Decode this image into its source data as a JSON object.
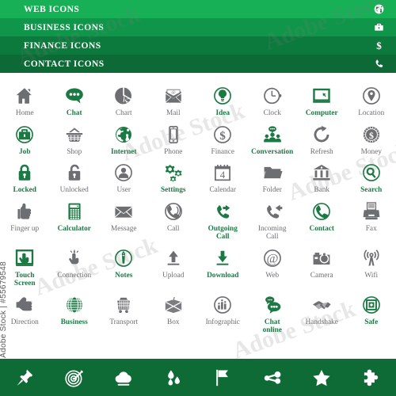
{
  "header": {
    "bars": [
      {
        "title": "WEB ICONS",
        "icon": "globe-icon",
        "bg": "#18b057"
      },
      {
        "title": "BUSINESS ICONS",
        "icon": "briefcase-icon",
        "bg": "#10964a"
      },
      {
        "title": "FINANCE ICONS",
        "icon": "dollar-icon",
        "bg": "#0b7a3c"
      },
      {
        "title": "CONTACT ICONS",
        "icon": "phone-icon",
        "bg": "#0d6a36"
      }
    ]
  },
  "colors": {
    "gray": "#6d6e71",
    "green": "#1b7a43",
    "bottom_bar_bg": "#0e6b36",
    "page_bg": "#ffffff"
  },
  "grid": {
    "rows": [
      [
        {
          "label": "Home",
          "icon": "home-icon",
          "color": "gray"
        },
        {
          "label": "Chat",
          "icon": "chat-bubble-icon",
          "color": "green"
        },
        {
          "label": "Chart",
          "icon": "pie-chart-icon",
          "color": "gray"
        },
        {
          "label": "Mail",
          "icon": "envelope-at-icon",
          "color": "gray"
        },
        {
          "label": "Idea",
          "icon": "lightbulb-icon",
          "color": "green"
        },
        {
          "label": "Clock",
          "icon": "clock-icon",
          "color": "gray"
        },
        {
          "label": "Computer",
          "icon": "laptop-icon",
          "color": "green"
        },
        {
          "label": "Location",
          "icon": "map-pin-icon",
          "color": "gray"
        }
      ],
      [
        {
          "label": "Job",
          "icon": "briefcase-icon",
          "color": "green"
        },
        {
          "label": "Shop",
          "icon": "basket-icon",
          "color": "gray"
        },
        {
          "label": "Internet",
          "icon": "globe-icon",
          "color": "green"
        },
        {
          "label": "Phone",
          "icon": "smartphone-icon",
          "color": "gray"
        },
        {
          "label": "Finance",
          "icon": "dollar-circle-icon",
          "color": "gray"
        },
        {
          "label": "Conversation",
          "icon": "group-chat-icon",
          "color": "green"
        },
        {
          "label": "Refresh",
          "icon": "refresh-arrow-icon",
          "color": "gray"
        },
        {
          "label": "Money",
          "icon": "coin-icon",
          "color": "gray"
        }
      ],
      [
        {
          "label": "Locked",
          "icon": "padlock-closed-icon",
          "color": "green"
        },
        {
          "label": "Unlocked",
          "icon": "padlock-open-icon",
          "color": "gray"
        },
        {
          "label": "User",
          "icon": "user-avatar-icon",
          "color": "gray"
        },
        {
          "label": "Settings",
          "icon": "gears-icon",
          "color": "green"
        },
        {
          "label": "Calendar",
          "icon": "calendar-icon",
          "color": "gray",
          "badge": "4"
        },
        {
          "label": "Folder",
          "icon": "folder-icon",
          "color": "gray"
        },
        {
          "label": "Bank",
          "icon": "bank-building-icon",
          "color": "gray"
        },
        {
          "label": "Search",
          "icon": "magnifier-icon",
          "color": "green"
        }
      ],
      [
        {
          "label": "Finger up",
          "icon": "thumbs-up-icon",
          "color": "gray"
        },
        {
          "label": "Calculator",
          "icon": "calculator-icon",
          "color": "green"
        },
        {
          "label": "Message",
          "icon": "envelope-icon",
          "color": "gray"
        },
        {
          "label": "Call",
          "icon": "phone-ringing-icon",
          "color": "gray"
        },
        {
          "label": "Outgoing\nCall",
          "icon": "outgoing-call-icon",
          "color": "green"
        },
        {
          "label": "Incoming\nCall",
          "icon": "incoming-call-icon",
          "color": "gray"
        },
        {
          "label": "Contact",
          "icon": "phone-circle-icon",
          "color": "green"
        },
        {
          "label": "Fax",
          "icon": "fax-printer-icon",
          "color": "gray"
        }
      ],
      [
        {
          "label": "Touch\nScreen",
          "icon": "touch-screen-icon",
          "color": "green"
        },
        {
          "label": "Connection",
          "icon": "pointing-hand-icon",
          "color": "gray"
        },
        {
          "label": "Notes",
          "icon": "pencil-circle-icon",
          "color": "green"
        },
        {
          "label": "Upload",
          "icon": "upload-arrow-icon",
          "color": "gray"
        },
        {
          "label": "Download",
          "icon": "download-arrow-icon",
          "color": "green"
        },
        {
          "label": "Web",
          "icon": "at-circle-icon",
          "color": "gray"
        },
        {
          "label": "Camera",
          "icon": "camera-icon",
          "color": "gray"
        },
        {
          "label": "Wifi",
          "icon": "wifi-tower-icon",
          "color": "gray"
        }
      ],
      [
        {
          "label": "Direction",
          "icon": "pointing-finger-icon",
          "color": "gray"
        },
        {
          "label": "Business",
          "icon": "wire-globe-icon",
          "color": "green"
        },
        {
          "label": "Transport",
          "icon": "cargo-wagon-icon",
          "color": "gray"
        },
        {
          "label": "Box",
          "icon": "package-box-icon",
          "color": "gray"
        },
        {
          "label": "Infographic",
          "icon": "bar-chart-circle-icon",
          "color": "gray"
        },
        {
          "label": "Chat\nonline",
          "icon": "double-chat-icon",
          "color": "green"
        },
        {
          "label": "Handshake",
          "icon": "handshake-icon",
          "color": "gray"
        },
        {
          "label": "Safe",
          "icon": "safe-box-icon",
          "color": "green"
        }
      ]
    ]
  },
  "bottom_bar": {
    "icons": [
      "pushpin-icon",
      "target-icon",
      "cloud-icon",
      "water-drops-icon",
      "flag-icon",
      "share-nodes-icon",
      "star-icon",
      "puzzle-piece-icon"
    ]
  },
  "watermarks": {
    "brand": "Adobe Stock",
    "id_text": "Adobe Stock | #55679548",
    "tiles": [
      "Adobe Stock",
      "Adobe Stock",
      "Adobe Stock",
      "Adobe Stock",
      "Adobe Stock",
      "Adobe Stock"
    ]
  }
}
